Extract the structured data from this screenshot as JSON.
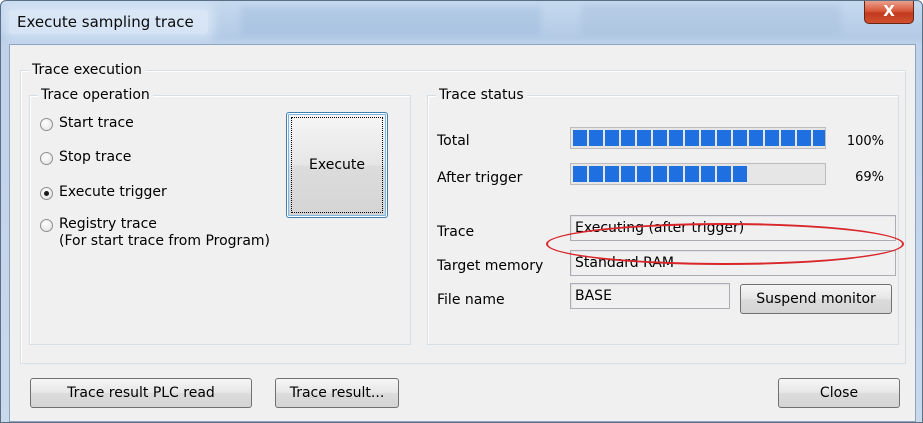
{
  "window": {
    "title": "Execute sampling trace",
    "close_label": "X"
  },
  "trace_execution": {
    "title": "Trace execution",
    "operation": {
      "title": "Trace operation",
      "options": [
        {
          "label": "Start trace",
          "checked": false
        },
        {
          "label": "Stop trace",
          "checked": false
        },
        {
          "label": "Execute trigger",
          "checked": true
        },
        {
          "label": "Registry trace",
          "checked": false
        }
      ],
      "registry_note": "(For start trace from Program)",
      "execute_label": "Execute"
    },
    "status": {
      "title": "Trace status",
      "total_label": "Total",
      "total_percent": "100%",
      "total_value": 1.0,
      "after_trigger_label": "After trigger",
      "after_trigger_percent": "69%",
      "after_trigger_value": 0.69,
      "trace_label": "Trace",
      "trace_value": "Executing (after trigger)",
      "target_memory_label": "Target memory",
      "target_memory_value": "Standard RAM",
      "file_name_label": "File name",
      "file_name_value": "BASE",
      "suspend_label": "Suspend monitor"
    }
  },
  "footer": {
    "plc_read_label": "Trace result PLC read",
    "trace_result_label": "Trace result...",
    "close_label": "Close"
  },
  "colors": {
    "progress": "#1f6fe0",
    "annotation": "#d8262a",
    "titlebar": "#b3cbe6"
  }
}
